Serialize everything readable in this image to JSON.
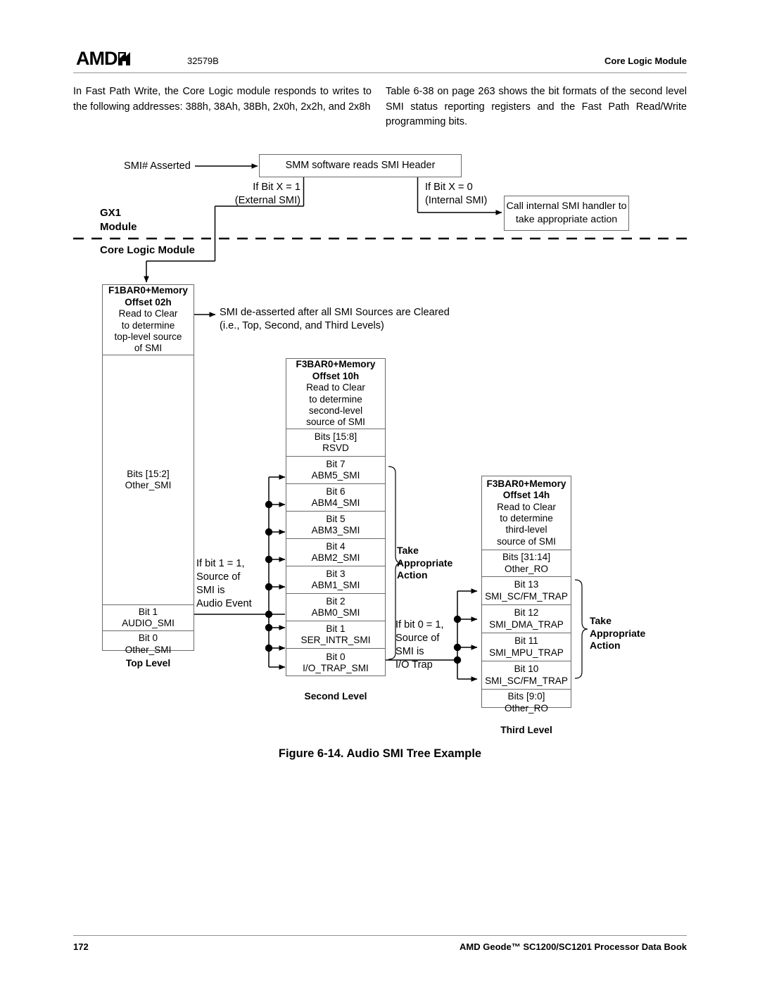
{
  "header": {
    "logo_text": "AMD",
    "logo_icon": "amd-arrow-logo",
    "doc_number": "32579B",
    "section_title": "Core Logic Module"
  },
  "body": {
    "left_paragraph": "In Fast Path Write, the Core Logic module responds to writes to the following addresses: 388h, 38Ah, 38Bh, 2x0h, 2x2h, and 2x8h",
    "right_paragraph": "Table 6-38 on page 263 shows the bit formats of the second level SMI status reporting registers and the Fast Path Read/Write programming bits."
  },
  "diagram": {
    "smi_asserted_label": "SMI# Asserted",
    "smm_box": "SMM software reads SMI Header",
    "branch_left": "If Bit X = 1\n(External SMI)",
    "branch_right": "If Bit X = 0\n(Internal SMI)",
    "internal_handler_box": "Call internal SMI handler\nto take appropriate action",
    "gx1_module_label": "GX1\nModule",
    "core_logic_label": "Core Logic Module",
    "deassert_note": "SMI de-asserted after all SMI Sources are Cleared\n(i.e., Top, Second, and Third Levels)",
    "audio_event_note": "If bit 1 = 1,\nSource of\nSMI is\nAudio Event",
    "io_trap_note": "If bit 0 = 1,\nSource of\nSMI is\nI/O Trap",
    "take_action_second": "Take\nAppropriate\nAction",
    "take_action_third": "Take\nAppropriate\nAction",
    "top_level": {
      "level_name": "Top Level",
      "header_lines": [
        "F1BAR0+Memory",
        "Offset 02h"
      ],
      "header_body": "Read to Clear\nto determine\ntop-level source\nof SMI",
      "rows": [
        {
          "bits": "Bits [15:2]",
          "name": "Other_SMI"
        },
        {
          "bits": "Bit 1",
          "name": "AUDIO_SMI"
        },
        {
          "bits": "Bit 0",
          "name": "Other_SMI"
        }
      ]
    },
    "second_level": {
      "level_name": "Second Level",
      "header_lines": [
        "F3BAR0+Memory",
        "Offset 10h"
      ],
      "header_body": "Read to Clear\nto determine\nsecond-level\nsource of SMI",
      "rows": [
        {
          "bits": "Bits [15:8]",
          "name": "RSVD"
        },
        {
          "bits": "Bit 7",
          "name": "ABM5_SMI"
        },
        {
          "bits": "Bit 6",
          "name": "ABM4_SMI"
        },
        {
          "bits": "Bit 5",
          "name": "ABM3_SMI"
        },
        {
          "bits": "Bit 4",
          "name": "ABM2_SMI"
        },
        {
          "bits": "Bit 3",
          "name": "ABM1_SMI"
        },
        {
          "bits": "Bit 2",
          "name": "ABM0_SMI"
        },
        {
          "bits": "Bit 1",
          "name": "SER_INTR_SMI"
        },
        {
          "bits": "Bit 0",
          "name": "I/O_TRAP_SMI"
        }
      ]
    },
    "third_level": {
      "level_name": "Third Level",
      "header_lines": [
        "F3BAR0+Memory",
        "Offset 14h"
      ],
      "header_body": "Read to Clear\nto determine\nthird-level\nsource of SMI",
      "rows": [
        {
          "bits": "Bits [31:14]",
          "name": "Other_RO"
        },
        {
          "bits": "Bit 13",
          "name": "SMI_SC/FM_TRAP"
        },
        {
          "bits": "Bit 12",
          "name": "SMI_DMA_TRAP"
        },
        {
          "bits": "Bit 11",
          "name": "SMI_MPU_TRAP"
        },
        {
          "bits": "Bit 10",
          "name": "SMI_SC/FM_TRAP"
        },
        {
          "bits": "Bits [9:0]",
          "name": "Other_RO"
        }
      ]
    },
    "figure_caption": "Figure 6-14.  Audio SMI Tree Example"
  },
  "footer": {
    "page_number": "172",
    "book_title": "AMD Geode™ SC1200/SC1201 Processor Data Book"
  },
  "colors": {
    "text": "#000000",
    "rule": "#949494",
    "box_border": "#6a6a6a",
    "line": "#000000",
    "page_bg": "#ffffff"
  }
}
